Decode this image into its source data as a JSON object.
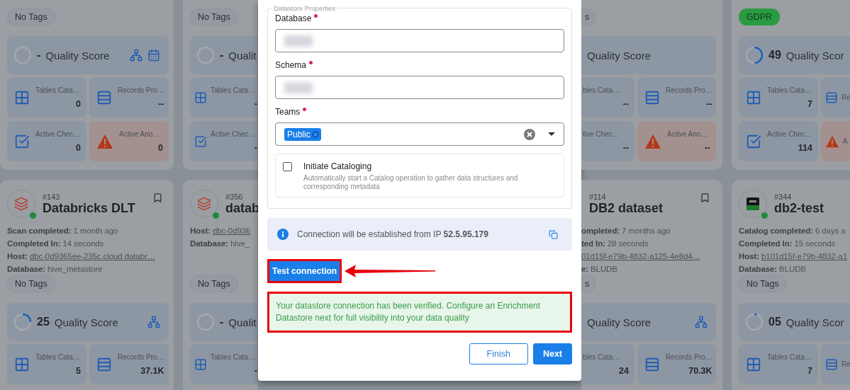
{
  "columns_left": [
    {
      "cards": [
        {
          "tags": [
            {
              "label": "No Tags",
              "kind": "none"
            }
          ],
          "quality": {
            "score": "-",
            "label": "Quality Score",
            "level": 0,
            "show_hierarchy": true,
            "show_calendar": true
          },
          "stats": [
            {
              "kind": "tables",
              "label": "Tables Cata…",
              "value": "0"
            },
            {
              "kind": "records",
              "label": "Records Pro…",
              "value": "--"
            },
            {
              "kind": "checks",
              "label": "Active Chec…",
              "value": "0"
            },
            {
              "kind": "anomalies",
              "label": "Active Ano…",
              "value": "0"
            }
          ]
        },
        {
          "kind": "databricks",
          "online": true,
          "bookmarked": false,
          "number": "#143",
          "title": "Databricks DLT",
          "meta": [
            {
              "label": "Scan completed:",
              "value": "1 month ago",
              "link": false
            },
            {
              "label": "Completed In:",
              "value": "14 seconds",
              "link": false
            },
            {
              "label": "Host:",
              "value": "dbc-0d9365ee-235c.cloud.databr…",
              "link": true
            },
            {
              "label": "Database:",
              "value": "hive_metastore",
              "link": false
            }
          ],
          "tags": [
            {
              "label": "No Tags",
              "kind": "none"
            }
          ],
          "quality": {
            "score": "25",
            "label": "Quality Score",
            "level": 0.25,
            "show_hierarchy": true
          },
          "stats": [
            {
              "kind": "tables",
              "label": "Tables Cata…",
              "value": "5"
            },
            {
              "kind": "records",
              "label": "Records Pro…",
              "value": "37.1K"
            }
          ]
        }
      ]
    },
    {
      "cards": [
        {
          "tags": [
            {
              "label": "No Tags",
              "kind": "none"
            }
          ],
          "quality": {
            "score": "-",
            "label": "Qualit",
            "level": 0
          },
          "stats": [
            {
              "kind": "tables",
              "label": "Tables Cata…",
              "value": "-"
            },
            {
              "kind": "checks",
              "label": "Active Chec…",
              "value": "-"
            }
          ]
        },
        {
          "kind": "databricks",
          "online": true,
          "number": "#356",
          "title": "datab",
          "meta": [
            {
              "label": "Host:",
              "value": "dbc-0d936",
              "link": true
            },
            {
              "label": "Database:",
              "value": "hive_",
              "link": false
            }
          ],
          "tags": [
            {
              "label": "No Tags",
              "kind": "none"
            }
          ],
          "quality": {
            "score": "-",
            "label": "Qualit",
            "level": 0
          },
          "stats": [
            {
              "kind": "tables",
              "label": "Tables Cata…",
              "value": "-"
            }
          ]
        }
      ]
    }
  ],
  "modal": {
    "legend": "Datastore Properties",
    "fields": [
      {
        "kind": "text",
        "label": "Database",
        "required": true,
        "redacted": true
      },
      {
        "kind": "text",
        "label": "Schema",
        "required": true,
        "redacted": true
      },
      {
        "kind": "select",
        "label": "Teams",
        "required": true,
        "chips": [
          "Public"
        ]
      }
    ],
    "cataloging": {
      "label": "Initiate Cataloging",
      "description": "Automatically start a Catalog operation to gather data structures and corresponding metadata",
      "checked": false
    },
    "info": "Connection will be established from IP **52.5.95.179**",
    "test_button": {
      "label": "Test connection",
      "highlighted": true,
      "callout_arrow": true
    },
    "success": {
      "text": "Your datastore connection has been verified. Configure an Enrichment Datastore next for full visibility into your data quality",
      "highlighted": true
    },
    "buttons": [
      {
        "label": "Finish",
        "kind": "outline"
      },
      {
        "label": "Next",
        "kind": "primary"
      }
    ]
  },
  "columns_right": [
    {
      "cards": [
        {
          "tags": [
            {
              "label": "s",
              "kind": "none"
            }
          ],
          "quality": {
            "label": "Quality Score"
          },
          "stats": [
            {
              "kind": "tables",
              "label": "bles Cata…",
              "value": "--"
            },
            {
              "kind": "records",
              "label": "Records Pro…",
              "value": "--"
            },
            {
              "kind": "checks",
              "label": "tive Chec…",
              "value": "--"
            },
            {
              "kind": "anomalies",
              "label": "Active Ano…",
              "value": "--"
            }
          ]
        },
        {
          "bookmarked": false,
          "number": "#114",
          "title": "DB2 dataset",
          "meta": [
            {
              "label": "ompleted:",
              "value": "7 months ago",
              "link": false
            },
            {
              "label": "ted In:",
              "value": "28 seconds",
              "link": false
            },
            {
              "value": "01d15f-e79b-4832-a125-4e8d4…",
              "link": true
            },
            {
              "label": "e:",
              "value": "BLUDB",
              "link": false
            }
          ],
          "tags": [
            {
              "label": "s",
              "kind": "none"
            }
          ],
          "quality": {
            "label": "Quality Score",
            "show_hierarchy": true
          },
          "stats": [
            {
              "kind": "tables",
              "label": "bles Cata…",
              "value": "24"
            },
            {
              "kind": "records",
              "label": "Records Pro…",
              "value": "70.3K"
            }
          ]
        }
      ]
    },
    {
      "cards": [
        {
          "tags": [
            {
              "label": "GDPR",
              "kind": "tag"
            }
          ],
          "quality": {
            "score": "49",
            "label": "Quality Scor",
            "level": 0.49
          },
          "stats": [
            {
              "kind": "tables",
              "label": "Tables Cata…",
              "value": "7"
            },
            {
              "kind": "records",
              "label": "Re"
            },
            {
              "kind": "checks",
              "label": "Active Chec…",
              "value": "114"
            },
            {
              "kind": "anomalies",
              "label": "A"
            }
          ]
        },
        {
          "kind": "db2",
          "online": true,
          "number": "#344",
          "title": "db2-test",
          "meta": [
            {
              "label": "Catalog completed:",
              "value": "6 days a",
              "link": false
            },
            {
              "label": "Completed In:",
              "value": "15 seconds",
              "link": false
            },
            {
              "label": "Host:",
              "value": "b101d15f-e79b-4832-a1",
              "link": true
            },
            {
              "label": "Database:",
              "value": "BLUDB",
              "link": false
            }
          ],
          "tags": [
            {
              "label": "No Tags",
              "kind": "none"
            }
          ],
          "quality": {
            "score": "05",
            "label": "Quality Scor",
            "level": 0.05
          },
          "stats": [
            {
              "kind": "tables",
              "label": "Tables Cata…",
              "value": "7"
            },
            {
              "kind": "records",
              "label": "Re"
            }
          ]
        }
      ]
    }
  ]
}
